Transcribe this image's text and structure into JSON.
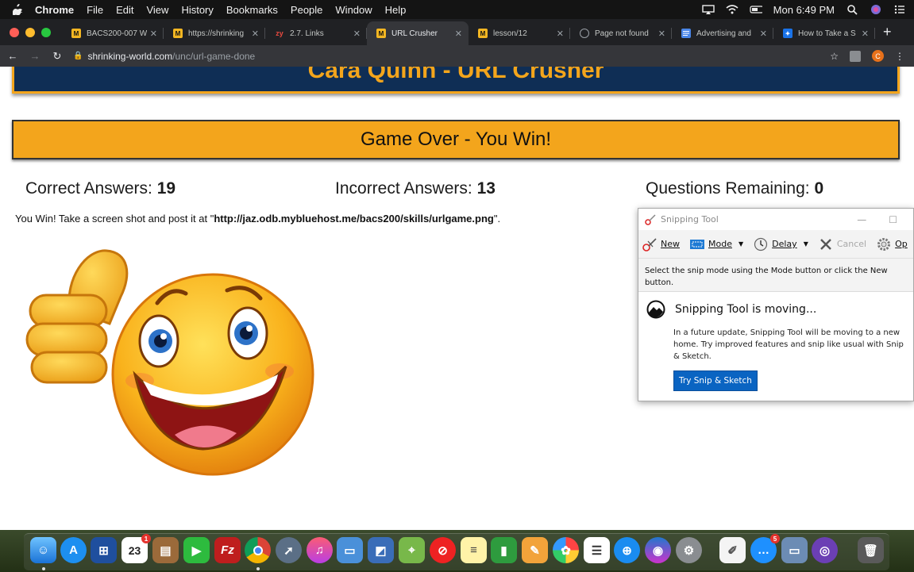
{
  "menubar": {
    "app": "Chrome",
    "items": [
      "File",
      "Edit",
      "View",
      "History",
      "Bookmarks",
      "People",
      "Window",
      "Help"
    ],
    "clock": "Mon 6:49 PM"
  },
  "tabs": [
    {
      "title": "BACS200-007 W",
      "favicon": "m-icon",
      "active": false
    },
    {
      "title": "https://shrinking",
      "favicon": "m-icon",
      "active": false
    },
    {
      "title": "2.7. Links",
      "favicon": "zy-icon",
      "active": false
    },
    {
      "title": "URL Crusher",
      "favicon": "m-icon",
      "active": true
    },
    {
      "title": "lesson/12",
      "favicon": "m-icon",
      "active": false
    },
    {
      "title": "Page not found",
      "favicon": "globe-icon",
      "active": false
    },
    {
      "title": "Advertising and",
      "favicon": "docs-icon",
      "active": false
    },
    {
      "title": "How to Take a S",
      "favicon": "bookmark-icon",
      "active": false
    }
  ],
  "address": {
    "host": "shrinking-world.com",
    "path": "/unc/url-game-done",
    "profile_initial": "C"
  },
  "page": {
    "title": "Cara Quinn - URL Crusher",
    "result": "Game Over - You Win!",
    "correct_label": "Correct Answers:",
    "correct_value": "19",
    "incorrect_label": "Incorrect Answers:",
    "incorrect_value": "13",
    "remaining_label": "Questions Remaining:",
    "remaining_value": "0",
    "instructions_prefix": "You Win! Take a screen shot and post it at \"",
    "instructions_url": "http://jaz.odb.mybluehost.me/bacs200/skills/urlgame.png",
    "instructions_suffix": "\"."
  },
  "snipping_tool": {
    "title": "Snipping Tool",
    "new_label": "New",
    "mode_label": "Mode",
    "delay_label": "Delay",
    "cancel_label": "Cancel",
    "options_label": "Op",
    "hint": "Select the snip mode using the Mode button or click the New button.",
    "notice_title": "Snipping Tool is moving...",
    "notice_body": "In a future update, Snipping Tool will be moving to a new home. Try improved features and snip like usual with Snip & Sketch.",
    "try_button": "Try Snip & Sketch"
  },
  "dock": {
    "calendar_day": "23",
    "calendar_badge": "1",
    "messages_badge": "5",
    "filezilla_label": "Fz"
  }
}
